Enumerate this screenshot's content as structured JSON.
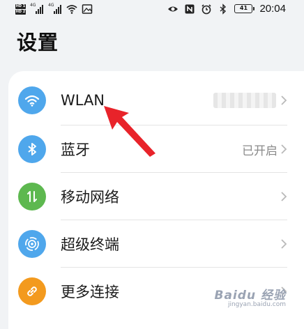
{
  "status_bar": {
    "hd_badge_1": "HD 1",
    "hd_badge_2": "HD 2",
    "net_1": "4G",
    "net_2": "4G",
    "battery": "41",
    "time": "20:04"
  },
  "page_title": "设置",
  "settings": [
    {
      "label": "WLAN",
      "value": "",
      "icon": "wifi-icon",
      "color": "#4fa7ec"
    },
    {
      "label": "蓝牙",
      "value": "已开启",
      "icon": "bluetooth-icon",
      "color": "#4fa7ec"
    },
    {
      "label": "移动网络",
      "value": "",
      "icon": "mobile-data-icon",
      "color": "#5db84f"
    },
    {
      "label": "超级终端",
      "value": "",
      "icon": "super-device-icon",
      "color": "#4fa7ec"
    },
    {
      "label": "更多连接",
      "value": "",
      "icon": "link-icon",
      "color": "#f39a1e"
    }
  ],
  "annotation": {
    "color": "#e8232a"
  },
  "watermark": {
    "line1": "Baidu 经验",
    "line2": "jingyan.baidu.com"
  }
}
